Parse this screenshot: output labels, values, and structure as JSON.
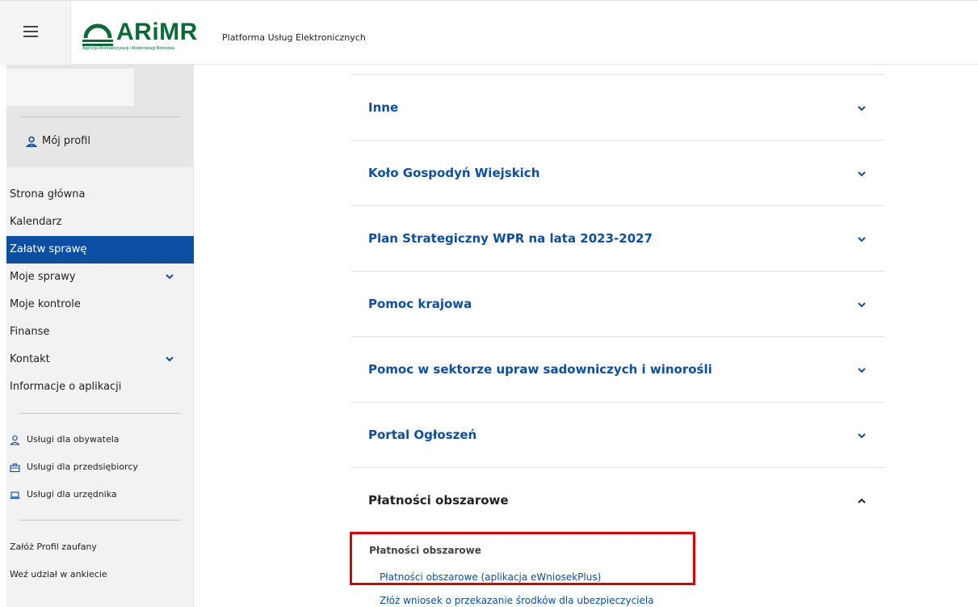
{
  "header": {
    "logo_text": "ARiMR",
    "logo_subtitle": "Agencja Restrukturyzacji i Modernizacji Rolnictwa",
    "platform_title": "Platforma Usług Elektronicznych"
  },
  "sidebar": {
    "profile_label": "Mój profil",
    "nav": [
      {
        "label": "Strona główna"
      },
      {
        "label": "Kalendarz"
      },
      {
        "label": "Załatw sprawę"
      },
      {
        "label": "Moje sprawy"
      },
      {
        "label": "Moje kontrole"
      },
      {
        "label": "Finanse"
      },
      {
        "label": "Kontakt"
      },
      {
        "label": "Informacje o aplikacji"
      }
    ],
    "services": [
      {
        "label": "Usługi dla obywatela",
        "icon": "person-icon"
      },
      {
        "label": "Usługi dla przedsiębiorcy",
        "icon": "briefcase-icon"
      },
      {
        "label": "Usługi dla urzędnika",
        "icon": "laptop-icon"
      }
    ],
    "extra": [
      {
        "label": "Załóż Profil zaufany"
      },
      {
        "label": "Weź udział w ankiecie"
      }
    ]
  },
  "accordion": [
    {
      "title": "Inne"
    },
    {
      "title": "Koło Gospodyń Wiejskich"
    },
    {
      "title": "Plan Strategiczny WPR na lata 2023-2027"
    },
    {
      "title": "Pomoc krajowa"
    },
    {
      "title": "Pomoc w sektorze upraw sadowniczych i winorośli"
    },
    {
      "title": "Portal Ogłoszeń"
    },
    {
      "title": "Płatności obszarowe"
    }
  ],
  "expanded": {
    "heading": "Płatności obszarowe",
    "links": [
      {
        "label": "Płatności obszarowe (aplikacja eWniosekPlus)"
      },
      {
        "label": "Złóż wniosek o przekazanie środków dla ubezpieczyciela"
      }
    ]
  },
  "colors": {
    "brand_green": "#0b6b34",
    "link_blue": "#0b4ea2",
    "active_bg": "#0b4ea2",
    "highlight_red": "#e00000"
  }
}
